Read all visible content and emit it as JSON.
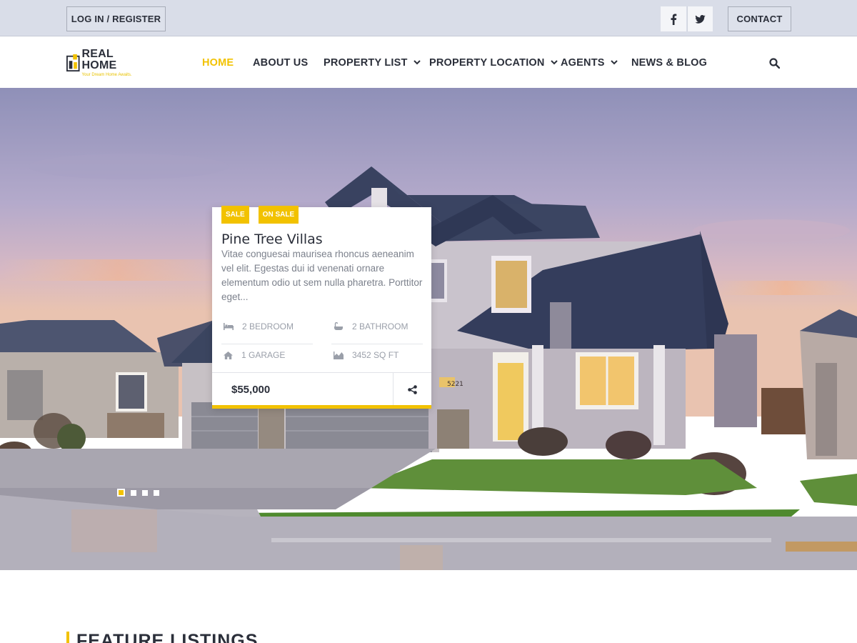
{
  "topbar": {
    "login_label": "LOG IN / REGISTER",
    "contact_label": "CONTACT"
  },
  "brand": {
    "name": "REAL HOME",
    "tagline": "Your Dream Home Awaits."
  },
  "nav": {
    "items": [
      {
        "label": "HOME"
      },
      {
        "label": "ABOUT US"
      },
      {
        "label": "PROPERTY LIST"
      },
      {
        "label": "PROPERTY LOCATION"
      },
      {
        "label": "AGENTS"
      },
      {
        "label": "NEWS & BLOG"
      }
    ]
  },
  "hero": {
    "house_number": "5221",
    "slide_count": 4,
    "active_slide": 1
  },
  "card": {
    "badges": [
      "SALE",
      "ON SALE"
    ],
    "title": "Pine Tree Villas",
    "description": "Vitae conguesai maurisea rhoncus aeneanim vel elit. Egestas dui id venenati ornare elementum odio ut sem nulla pharetra. Porttitor eget...",
    "features": {
      "bedroom": "2 BEDROOM",
      "bathroom": "2 BATHROOM",
      "garage": "1 GARAGE",
      "area": "3452 SQ FT"
    },
    "price": "$55,000"
  },
  "section": {
    "heading": "FEATURE LISTINGS"
  },
  "colors": {
    "accent": "#f2c200",
    "text_dark": "#2b2f3a",
    "topbar_bg": "#d9dde8"
  },
  "icons": [
    "facebook-icon",
    "twitter-icon",
    "search-icon",
    "chevron-down-icon",
    "bed-icon",
    "bath-icon",
    "home-icon",
    "area-icon",
    "share-icon"
  ]
}
